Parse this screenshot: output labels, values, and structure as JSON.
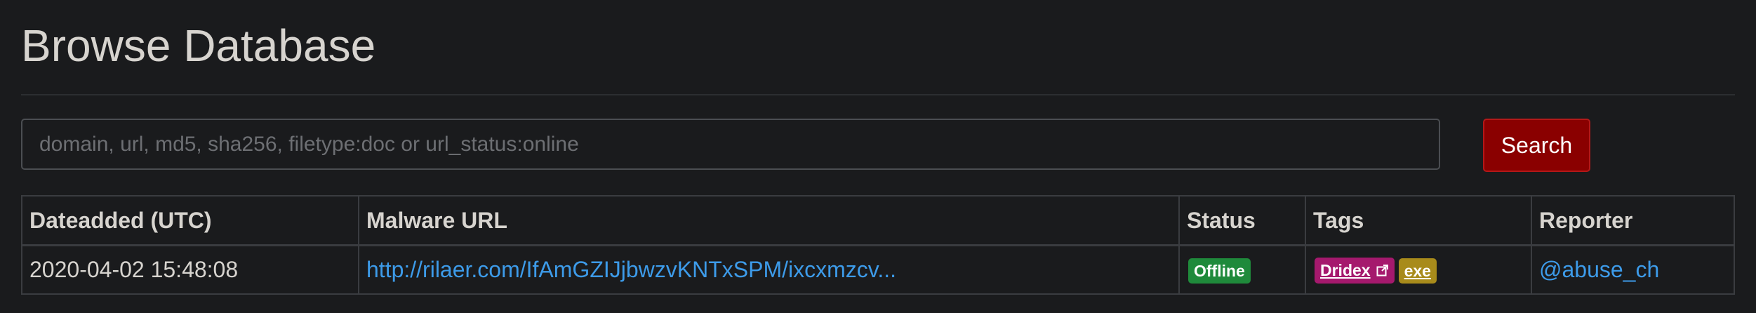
{
  "page": {
    "title": "Browse Database"
  },
  "search": {
    "placeholder": "domain, url, md5, sha256, filetype:doc or url_status:online",
    "value": "",
    "button_label": "Search"
  },
  "table": {
    "columns": [
      "Dateadded (UTC)",
      "Malware URL",
      "Status",
      "Tags",
      "Reporter"
    ],
    "rows": [
      {
        "dateadded": "2020-04-02 15:48:08",
        "url": "http://rilaer.com/IfAmGZIJjbwzvKNTxSPM/ixcxmzcv...",
        "status": "Offline",
        "tags": [
          {
            "label": "Dridex",
            "icon": "external-link-icon"
          },
          {
            "label": "exe"
          }
        ],
        "reporter": "@abuse_ch"
      }
    ]
  },
  "colors": {
    "background": "#1a1b1d",
    "search_button": "#8a0000",
    "link": "#3d9be9",
    "status_offline": "#1f8a3b",
    "tag_dridex": "#a5196d",
    "tag_exe": "#a88b1b"
  }
}
